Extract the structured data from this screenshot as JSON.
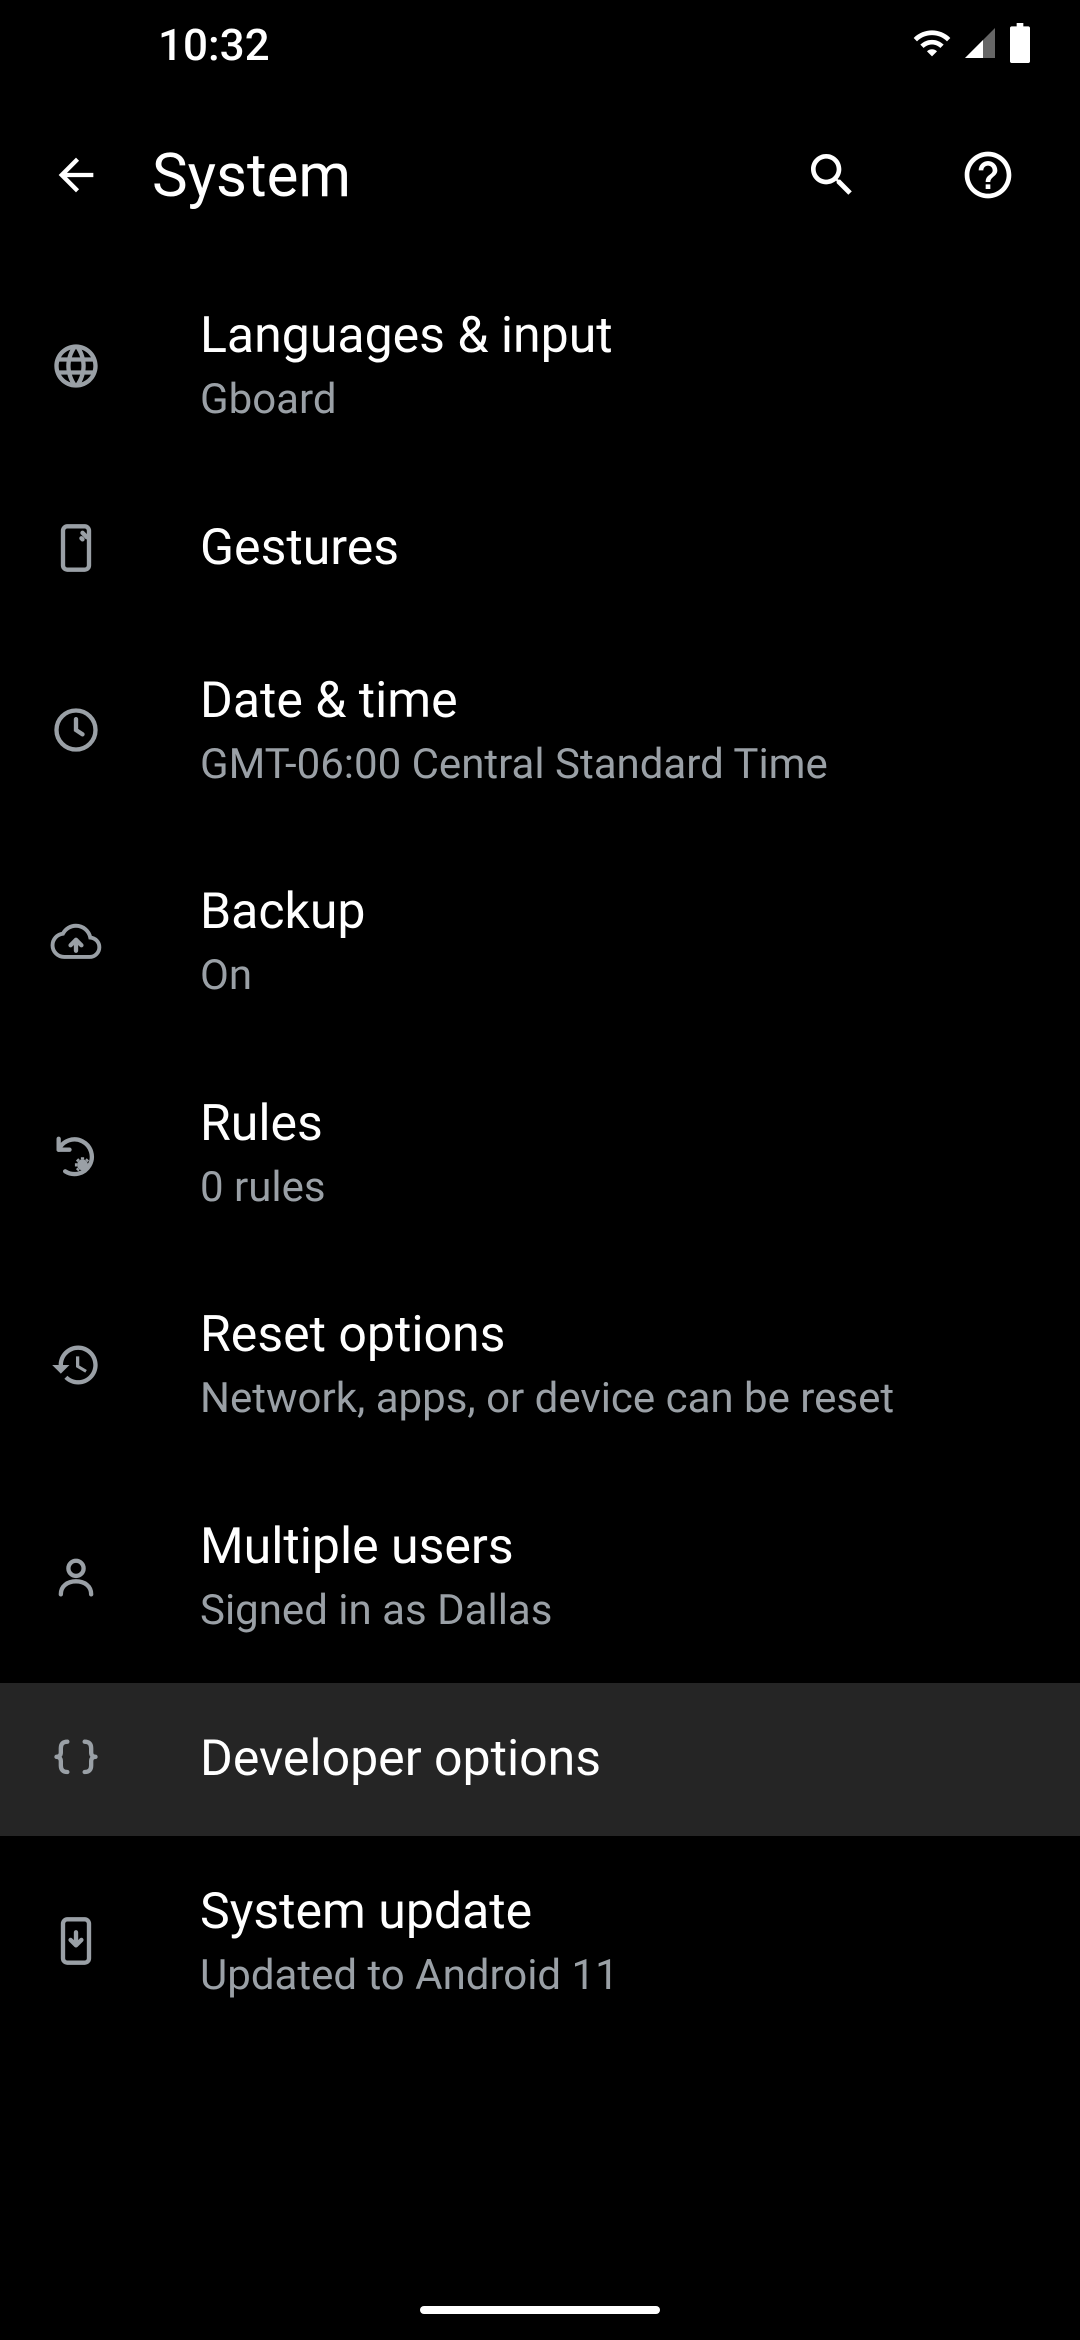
{
  "status": {
    "time": "10:32"
  },
  "header": {
    "title": "System"
  },
  "items": [
    {
      "title": "Languages & input",
      "subtitle": "Gboard"
    },
    {
      "title": "Gestures",
      "subtitle": ""
    },
    {
      "title": "Date & time",
      "subtitle": "GMT-06:00 Central Standard Time"
    },
    {
      "title": "Backup",
      "subtitle": "On"
    },
    {
      "title": "Rules",
      "subtitle": "0 rules"
    },
    {
      "title": "Reset options",
      "subtitle": "Network, apps, or device can be reset"
    },
    {
      "title": "Multiple users",
      "subtitle": "Signed in as Dallas"
    },
    {
      "title": "Developer options",
      "subtitle": ""
    },
    {
      "title": "System update",
      "subtitle": "Updated to Android 11"
    }
  ]
}
